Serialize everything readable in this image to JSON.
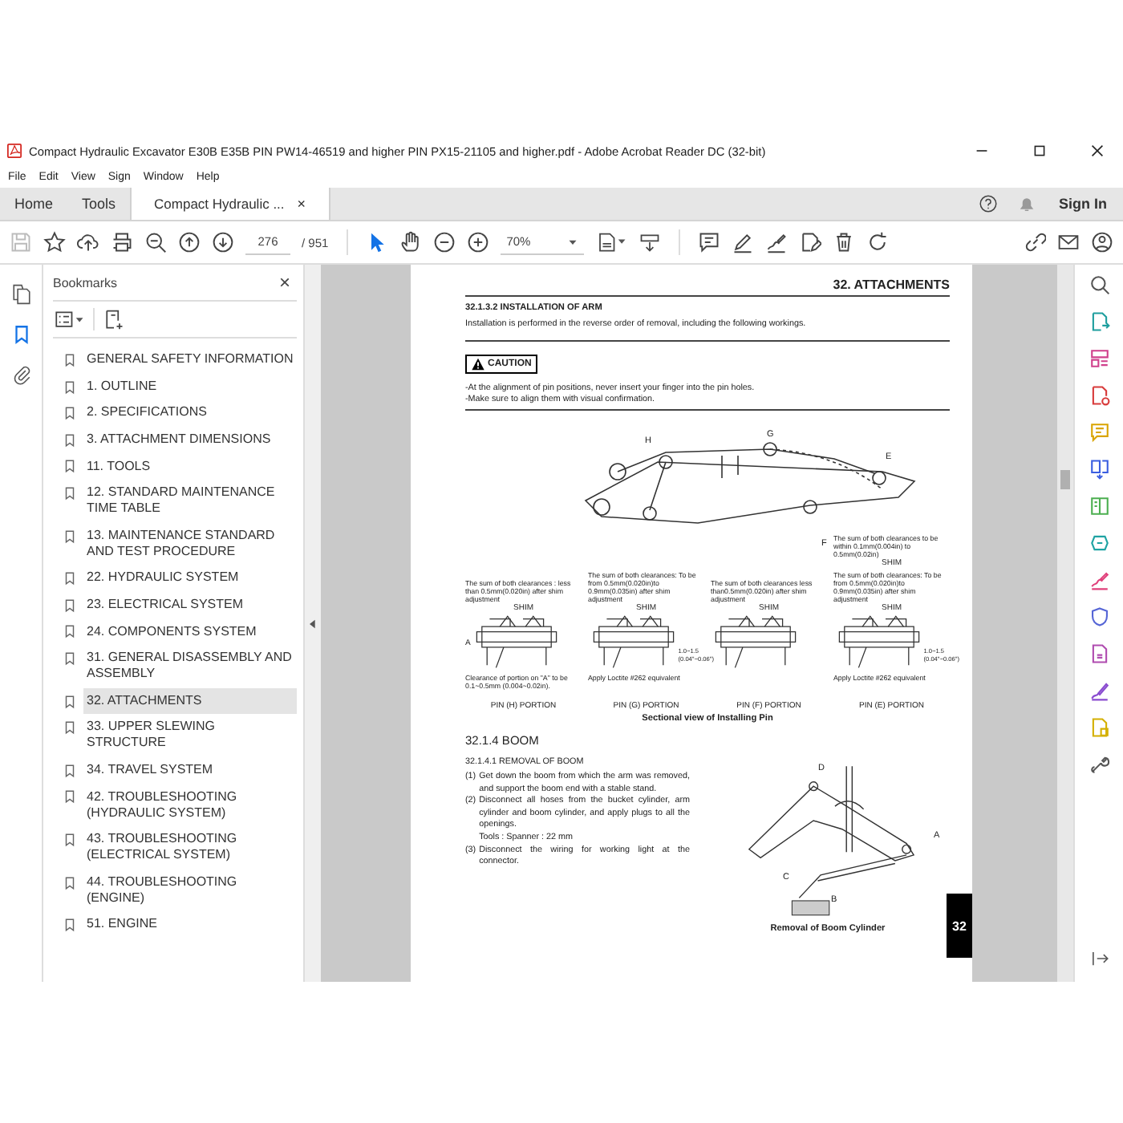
{
  "window": {
    "title": "Compact Hydraulic Excavator E30B E35B PIN PW14-46519 and higher PIN PX15-21105 and higher.pdf - Adobe Acrobat Reader DC (32-bit)"
  },
  "menu": [
    "File",
    "Edit",
    "View",
    "Sign",
    "Window",
    "Help"
  ],
  "tabs": [
    {
      "label": "Home",
      "selected": false
    },
    {
      "label": "Tools",
      "selected": false
    },
    {
      "label": "Compact Hydraulic ...",
      "selected": true,
      "close": "×"
    }
  ],
  "sign_in": "Sign In",
  "toolbar": {
    "page": "276",
    "total": "/ 951",
    "zoom": "70%"
  },
  "left_rail": [
    {
      "kind": "pages",
      "selected": false
    },
    {
      "kind": "bookmarks",
      "selected": true
    },
    {
      "kind": "attachments",
      "selected": false
    }
  ],
  "bookmarks": {
    "title": "Bookmarks",
    "close": "×",
    "items": [
      {
        "label": "GENERAL SAFETY INFORMATION",
        "selected": false
      },
      {
        "label": "1. OUTLINE",
        "selected": false
      },
      {
        "label": "2. SPECIFICATIONS",
        "selected": false
      },
      {
        "label": "3. ATTACHMENT DIMENSIONS",
        "selected": false
      },
      {
        "label": "11. TOOLS",
        "selected": false
      },
      {
        "label": "12. STANDARD MAINTENANCE TIME TABLE",
        "selected": false
      },
      {
        "label": "13. MAINTENANCE STANDARD AND TEST PROCEDURE",
        "selected": false
      },
      {
        "label": "22. HYDRAULIC SYSTEM",
        "selected": false
      },
      {
        "label": "23. ELECTRICAL SYSTEM",
        "selected": false
      },
      {
        "label": "24. COMPONENTS SYSTEM",
        "selected": false
      },
      {
        "label": "31. GENERAL DISASSEMBLY AND ASSEMBLY",
        "selected": false
      },
      {
        "label": "32. ATTACHMENTS",
        "selected": true
      },
      {
        "label": "33. UPPER SLEWING STRUCTURE",
        "selected": false
      },
      {
        "label": "34. TRAVEL SYSTEM",
        "selected": false
      },
      {
        "label": "42. TROUBLESHOOTING (HYDRAULIC SYSTEM)",
        "selected": false
      },
      {
        "label": "43. TROUBLESHOOTING (ELECTRICAL SYSTEM)",
        "selected": false
      },
      {
        "label": "44. TROUBLESHOOTING (ENGINE)",
        "selected": false
      },
      {
        "label": "51. ENGINE",
        "selected": false
      }
    ]
  },
  "document": {
    "running_header": "32.  ATTACHMENTS",
    "section_title": "32.1.3.2 INSTALLATION OF ARM",
    "intro": "Installation is performed in the reverse order of removal, including the following workings.",
    "caution": {
      "label": "CAUTION",
      "lines": [
        "-At the alignment of pin positions, never insert your finger into the pin holes.",
        "-Make sure to align them with visual confirmation."
      ]
    },
    "arm_callouts": [
      "H",
      "G",
      "E",
      "F"
    ],
    "pin_columns": [
      {
        "notes": [
          {
            "text": "The sum of both clearances : less than 0.5mm(0.020in) after shim adjustment",
            "shim": "SHIM"
          }
        ],
        "callout": "A",
        "below": "Clearance of portion on \"A\" to be 0.1~0.5mm (0.004~0.02in).",
        "portion": "PIN (H) PORTION"
      },
      {
        "notes": [
          {
            "text": "The sum of both clearances: To be from 0.5mm(0.020in)to 0.9mm(0.035in) after shim adjustment",
            "shim": "SHIM"
          }
        ],
        "dimension": "1.0~1.5",
        "dimension_inch": "(0.04\"~0.06\")",
        "below": "Apply Loctite #262 equivalent",
        "portion": "PIN (G) PORTION"
      },
      {
        "notes": [
          {
            "text": "The sum of both clearances less than0.5mm(0.020in) after shim adjustment",
            "shim": "SHIM"
          }
        ],
        "portion": "PIN (F) PORTION"
      },
      {
        "notes": [
          {
            "text": "The sum of both clearances to be within 0.1mm(0.004in) to 0.5mm(0.02in)",
            "shim": "SHIM"
          },
          {
            "text": "The sum of both clearances: To be from 0.5mm(0.020in)to 0.9mm(0.035in) after shim adjustment",
            "shim": "SHIM"
          }
        ],
        "dimension": "1.0~1.5",
        "dimension_inch": "(0.04\"~0.06\")",
        "below": "Apply Loctite #262 equivalent",
        "portion": "PIN (E) PORTION"
      }
    ],
    "pin_caption": "Sectional view of Installing Pin",
    "boom_heading": "32.1.4  BOOM",
    "boom_subtitle": "32.1.4.1 REMOVAL OF BOOM",
    "steps": [
      {
        "num": "(1)",
        "text": "Get down the boom from which the arm was removed, and support the boom end with a stable stand."
      },
      {
        "num": "(2)",
        "text": "Disconnect all hoses from the bucket cylinder, arm cylinder and boom cylinder, and apply plugs to all the openings.",
        "note": "Tools : Spanner : 22 mm"
      },
      {
        "num": "(3)",
        "text": "Disconnect the wiring for working light at the connector."
      }
    ],
    "boom_callouts": [
      "D",
      "C",
      "B",
      "A"
    ],
    "boom_caption": "Removal of Boom Cylinder",
    "page_tab": "32"
  }
}
